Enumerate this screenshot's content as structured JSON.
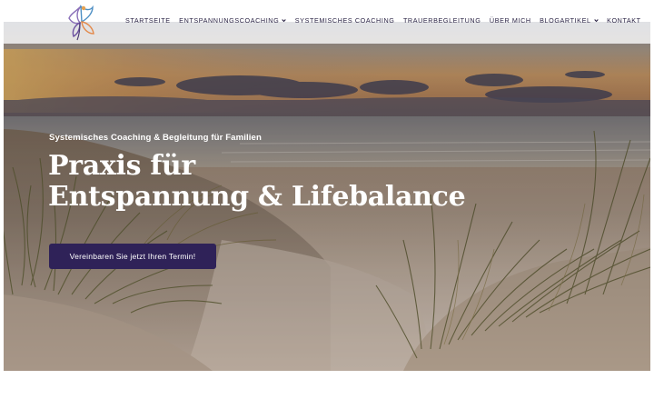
{
  "header": {
    "logo_icon": "butterfly-figure-logo",
    "nav": [
      {
        "label": "STARTSEITE",
        "dropdown": false
      },
      {
        "label": "ENTSPANNUNGSCOACHING",
        "dropdown": true
      },
      {
        "label": "SYSTEMISCHES COACHING",
        "dropdown": false
      },
      {
        "label": "TRAUERBEGLEITUNG",
        "dropdown": false
      },
      {
        "label": "ÜBER MICH",
        "dropdown": false
      },
      {
        "label": "BLOGARTIKEL",
        "dropdown": true
      },
      {
        "label": "KONTAKT",
        "dropdown": false
      }
    ]
  },
  "hero": {
    "background": "beach-dunes-sunset-photo",
    "subtitle": "Systemisches Coaching & Begleitung für Familien",
    "title_line1": "Praxis für",
    "title_line2": "Entspannung & Lifebalance",
    "cta_label": "Vereinbaren Sie jetzt Ihren Termin!"
  },
  "colors": {
    "brand": "#2f2258",
    "nav_text": "#2a2344"
  }
}
